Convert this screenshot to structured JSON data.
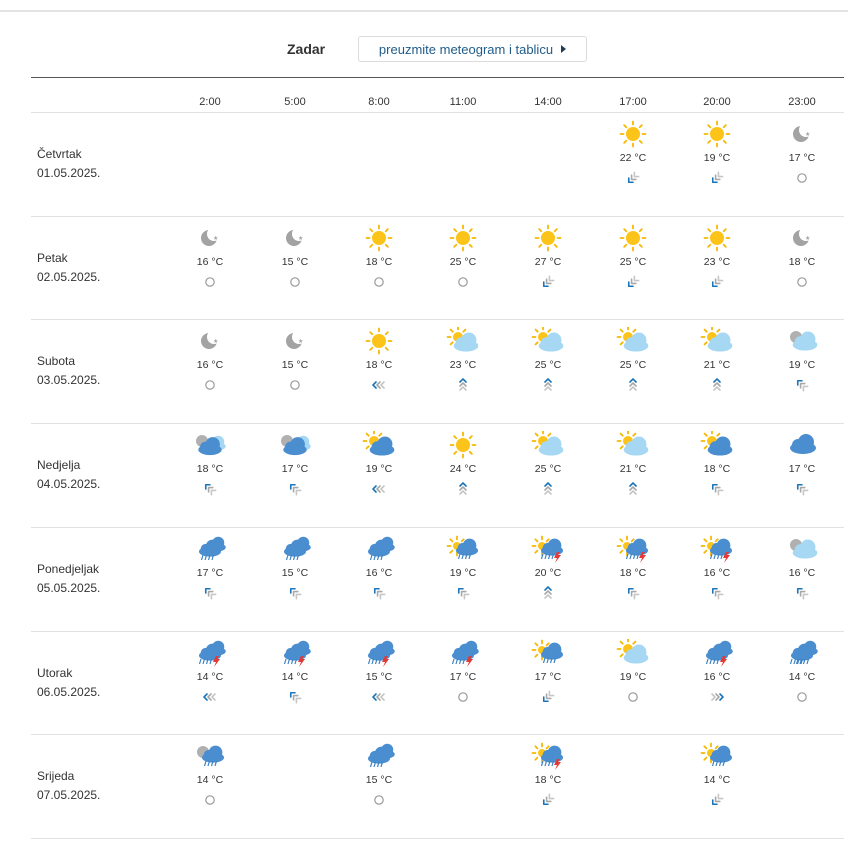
{
  "header": {
    "city": "Zadar",
    "download_label": "preuzmite meteogram i tablicu"
  },
  "hours": [
    "2:00",
    "5:00",
    "8:00",
    "11:00",
    "14:00",
    "17:00",
    "20:00",
    "23:00"
  ],
  "days": [
    {
      "name": "Četvrtak",
      "date": "01.05.2025.",
      "cells": [
        null,
        null,
        null,
        null,
        null,
        {
          "icon": "sun",
          "temp": "22 °C",
          "wind": "sw"
        },
        {
          "icon": "sun",
          "temp": "19 °C",
          "wind": "sw"
        },
        {
          "icon": "moon",
          "temp": "17 °C",
          "wind": "calm"
        }
      ]
    },
    {
      "name": "Petak",
      "date": "02.05.2025.",
      "cells": [
        {
          "icon": "moon",
          "temp": "16 °C",
          "wind": "calm"
        },
        {
          "icon": "moon",
          "temp": "15 °C",
          "wind": "calm"
        },
        {
          "icon": "sun",
          "temp": "18 °C",
          "wind": "calm"
        },
        {
          "icon": "sun",
          "temp": "25 °C",
          "wind": "calm"
        },
        {
          "icon": "sun",
          "temp": "27 °C",
          "wind": "sw"
        },
        {
          "icon": "sun",
          "temp": "25 °C",
          "wind": "sw"
        },
        {
          "icon": "sun",
          "temp": "23 °C",
          "wind": "sw"
        },
        {
          "icon": "moon",
          "temp": "18 °C",
          "wind": "calm"
        }
      ]
    },
    {
      "name": "Subota",
      "date": "03.05.2025.",
      "cells": [
        {
          "icon": "moon",
          "temp": "16 °C",
          "wind": "calm"
        },
        {
          "icon": "moon",
          "temp": "15 °C",
          "wind": "calm"
        },
        {
          "icon": "sun",
          "temp": "18 °C",
          "wind": "w"
        },
        {
          "icon": "sun-lightcloud",
          "temp": "23 °C",
          "wind": "n"
        },
        {
          "icon": "sun-lightcloud",
          "temp": "25 °C",
          "wind": "n"
        },
        {
          "icon": "sun-lightcloud",
          "temp": "25 °C",
          "wind": "n"
        },
        {
          "icon": "sun-lightcloud",
          "temp": "21 °C",
          "wind": "n"
        },
        {
          "icon": "moon-lightcloud",
          "temp": "19 °C",
          "wind": "nw"
        }
      ]
    },
    {
      "name": "Nedjelja",
      "date": "04.05.2025.",
      "cells": [
        {
          "icon": "moon-cloud",
          "temp": "18 °C",
          "wind": "nw"
        },
        {
          "icon": "moon-cloud",
          "temp": "17 °C",
          "wind": "nw"
        },
        {
          "icon": "sun-cloud",
          "temp": "19 °C",
          "wind": "w"
        },
        {
          "icon": "sun",
          "temp": "24 °C",
          "wind": "n"
        },
        {
          "icon": "sun-lightcloud",
          "temp": "25 °C",
          "wind": "n"
        },
        {
          "icon": "sun-lightcloud",
          "temp": "21 °C",
          "wind": "n"
        },
        {
          "icon": "sun-cloud",
          "temp": "18 °C",
          "wind": "nw"
        },
        {
          "icon": "cloud",
          "temp": "17 °C",
          "wind": "nw"
        }
      ]
    },
    {
      "name": "Ponedjeljak",
      "date": "05.05.2025.",
      "cells": [
        {
          "icon": "cloud-rain",
          "temp": "17 °C",
          "wind": "nw"
        },
        {
          "icon": "cloud-rain",
          "temp": "15 °C",
          "wind": "nw"
        },
        {
          "icon": "cloud-rain",
          "temp": "16 °C",
          "wind": "nw"
        },
        {
          "icon": "sun-cloud-rain",
          "temp": "19 °C",
          "wind": "nw"
        },
        {
          "icon": "sun-storm",
          "temp": "20 °C",
          "wind": "n"
        },
        {
          "icon": "sun-storm",
          "temp": "18 °C",
          "wind": "nw"
        },
        {
          "icon": "sun-storm",
          "temp": "16 °C",
          "wind": "nw"
        },
        {
          "icon": "moon-lightcloud",
          "temp": "16 °C",
          "wind": "nw"
        }
      ]
    },
    {
      "name": "Utorak",
      "date": "06.05.2025.",
      "cells": [
        {
          "icon": "storm",
          "temp": "14 °C",
          "wind": "w"
        },
        {
          "icon": "storm",
          "temp": "14 °C",
          "wind": "nw"
        },
        {
          "icon": "storm",
          "temp": "15 °C",
          "wind": "w"
        },
        {
          "icon": "storm",
          "temp": "17 °C",
          "wind": "calm"
        },
        {
          "icon": "sun-cloud-rain",
          "temp": "17 °C",
          "wind": "sw"
        },
        {
          "icon": "sun-lightcloud",
          "temp": "19 °C",
          "wind": "calm"
        },
        {
          "icon": "storm",
          "temp": "16 °C",
          "wind": "e"
        },
        {
          "icon": "cloud-heavyrain",
          "temp": "14 °C",
          "wind": "calm"
        }
      ]
    },
    {
      "name": "Srijeda",
      "date": "07.05.2025.",
      "cells": [
        {
          "icon": "moon-cloud-rain",
          "temp": "14 °C",
          "wind": "calm"
        },
        null,
        {
          "icon": "cloud-rain",
          "temp": "15 °C",
          "wind": "calm"
        },
        null,
        {
          "icon": "sun-storm",
          "temp": "18 °C",
          "wind": "sw"
        },
        null,
        {
          "icon": "sun-cloud-rain",
          "temp": "14 °C",
          "wind": "sw2"
        },
        null
      ]
    }
  ]
}
